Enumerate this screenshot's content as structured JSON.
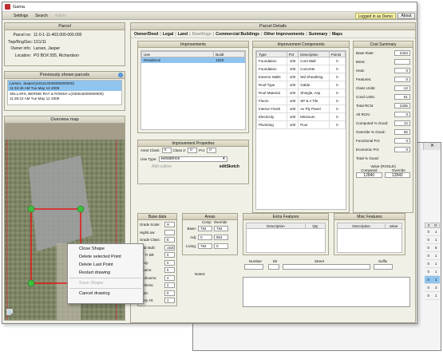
{
  "app": {
    "title": "Gama"
  },
  "menu": {
    "items": [
      "Settings",
      "Search",
      "Admin"
    ],
    "logged_in": "Logged in as Demo",
    "about": "About"
  },
  "left": {
    "parcel_header": "Parcel",
    "parcel_fields": [
      {
        "label": "Parcel no:",
        "value": "11-0-1-11-403.000-000.000"
      },
      {
        "label": "Twp/Rng/Sec:",
        "value": "1/11/11"
      },
      {
        "label": "Owner info:",
        "value": "Larsen, Jasper"
      },
      {
        "label": "Location:",
        "value": "PO BOX 555, Richardson"
      }
    ],
    "prev_header": "Previously shown parcels",
    "prev_items": [
      {
        "line1": "Larsen, Jasper(1101114030000000000)",
        "line2": "11:34:45 AM Tue May 12 2009"
      },
      {
        "line1": "SELLARS, BERNIE RAY & RONDA L(030515000000000)",
        "line2": "11:36:22 AM Tue May 12 2009"
      }
    ],
    "map_header": "Overview map"
  },
  "context_menu": {
    "items": [
      {
        "label": "Close Shape",
        "disabled": false
      },
      {
        "label": "Delete selected Point",
        "disabled": false
      },
      {
        "label": "Delete Last Point",
        "disabled": false
      },
      {
        "label": "Restart drawing",
        "disabled": false
      },
      {
        "label": "Save Shape",
        "disabled": true
      },
      {
        "label": "Cancel drawing",
        "disabled": false
      }
    ]
  },
  "map_behind_labels": [
    {
      "label": "Grade Scale:",
      "value": "H"
    },
    {
      "label": "High/Low:",
      "value": ""
    },
    {
      "label": "Grade Class:",
      "value": "E"
    },
    {
      "label": "Year Built:",
      "value": "1520"
    },
    {
      "label": "Eff Yr Blt:",
      "value": "0"
    },
    {
      "label": "...ory:",
      "value": "0"
    },
    {
      "label": "...ooms:",
      "value": "5"
    },
    {
      "label": "...ooms:",
      "value": "4"
    },
    {
      "label": "...throom:",
      "value": "2"
    },
    {
      "label": "...style:",
      "value": "0"
    },
    {
      "label": "...ory Ht:",
      "value": "1"
    }
  ],
  "details": {
    "header": "Parcel Details",
    "tabs": [
      "Owner/Deed",
      "Legal",
      "Land",
      "Dwellings",
      "Commercial Buildings",
      "Other Improvements",
      "Summary",
      "Maps"
    ],
    "improvements": {
      "title": "Improvements",
      "cols": [
        "Use",
        "Build"
      ],
      "rows": [
        [
          "Residence",
          "1520"
        ]
      ]
    },
    "components": {
      "title": "Improvement Components",
      "cols": [
        "Type",
        "Pct",
        "Description",
        "Points"
      ],
      "rows": [
        [
          "Foundation",
          "100",
          "Cont Wall",
          "0"
        ],
        [
          "Foundation",
          "100",
          "Concrete",
          "0"
        ],
        [
          "Exterior Walls",
          "100",
          "Wd Sheathing",
          "0"
        ],
        [
          "Roof Type",
          "100",
          "Gable",
          "0"
        ],
        [
          "Roof Material",
          "100",
          "Shingle, Asp",
          "0"
        ],
        [
          "Floors",
          "100",
          "SP & A Tile",
          "0"
        ],
        [
          "Interior Finish",
          "100",
          "Av Ply Panel",
          "0"
        ],
        [
          "Electricity",
          "100",
          "Minimum",
          "0"
        ],
        [
          "Plumbing",
          "100",
          "Poor",
          "0"
        ]
      ]
    },
    "cost": {
      "title": "Cost Summary",
      "fields": [
        {
          "label": "Base Rate:",
          "value": "2334"
        },
        {
          "label": "Bsmt:",
          "value": ""
        },
        {
          "label": "Heat:",
          "value": "0"
        },
        {
          "label": "Features:",
          "value": "0"
        },
        {
          "label": "Class Units:",
          "value": "-12"
        },
        {
          "label": "Cond Units:",
          "value": "81"
        },
        {
          "label": "Total RCN:",
          "value": "2335"
        },
        {
          "label": "Alt RCN:",
          "value": "0"
        },
        {
          "label": "Computed % Good:",
          "value": "12"
        },
        {
          "label": "Override % Good:",
          "value": "55"
        },
        {
          "label": "Functional Pct:",
          "value": "0"
        },
        {
          "label": "Economic Pct:",
          "value": "0"
        },
        {
          "label": "Total % Good:",
          "value": ""
        }
      ],
      "value_label": "Value (RCNLD)",
      "computed_label": "Computed",
      "override_label": "Override",
      "computed_value": "12840",
      "override_value": "12840"
    },
    "props": {
      "title": "Improvement Properties",
      "asmt_label": "Asmt Class:",
      "asmt_value": "0",
      "class2_label": "Class 2:",
      "class2_value": "0",
      "pct_label": "Pct:",
      "pct_value": "0",
      "use_type_label": "Use Type:",
      "use_type_value": "Residence",
      "add_outline": "Add outline",
      "edit_sketch": "editSketch"
    },
    "base": {
      "title": "Base data",
      "fields": [
        {
          "label": "Grade Scale:",
          "value": "H"
        },
        {
          "label": "High/Low:",
          "value": ""
        },
        {
          "label": "Grade Class:",
          "value": "E"
        },
        {
          "label": "Year Built:",
          "value": "1520"
        },
        {
          "label": "Eff Yr Blt:",
          "value": "0"
        },
        {
          "label": "Story:",
          "value": "0"
        },
        {
          "label": "Rooms:",
          "value": "5"
        },
        {
          "label": "Bedrooms:",
          "value": "4"
        },
        {
          "label": "Bathrms:",
          "value": "2"
        },
        {
          "label": "Style:",
          "value": "0"
        },
        {
          "label": "Story Ht:",
          "value": "1"
        }
      ]
    },
    "areas": {
      "title": "Areas",
      "comp": "Comp",
      "override": "Override",
      "rows": [
        {
          "label": "Base:",
          "comp": "784",
          "override": "784"
        },
        {
          "label": "Adj:",
          "comp": "0",
          "override": "804"
        },
        {
          "label": "Living:",
          "comp": "784",
          "override": "0"
        }
      ]
    },
    "extra": {
      "title": "Extra Features",
      "cols": [
        "Description",
        "Qty"
      ]
    },
    "misc": {
      "title": "Misc Features",
      "cols": [
        "Description",
        "value"
      ]
    },
    "address": {
      "number": "Number",
      "dir": "Dir",
      "street": "Street",
      "suffix": "Suffix",
      "notes": "Notes:"
    }
  },
  "back_window": {
    "col_headers": [
      "C",
      "O"
    ],
    "rows": [
      [
        "0",
        "1"
      ],
      [
        "0",
        "1"
      ],
      [
        "0",
        "5"
      ],
      [
        "0",
        "1"
      ],
      [
        "0",
        "1"
      ],
      [
        "0",
        "1"
      ],
      [
        "0",
        "1"
      ],
      [
        "0",
        "3"
      ],
      [
        "0",
        "1"
      ]
    ]
  },
  "colors": {
    "accent": "#4a8fd8",
    "selected": "#8fc4ee",
    "title_red": "#c03030",
    "polygon": "#e41a1a",
    "vertex": "#3fbf3f"
  }
}
